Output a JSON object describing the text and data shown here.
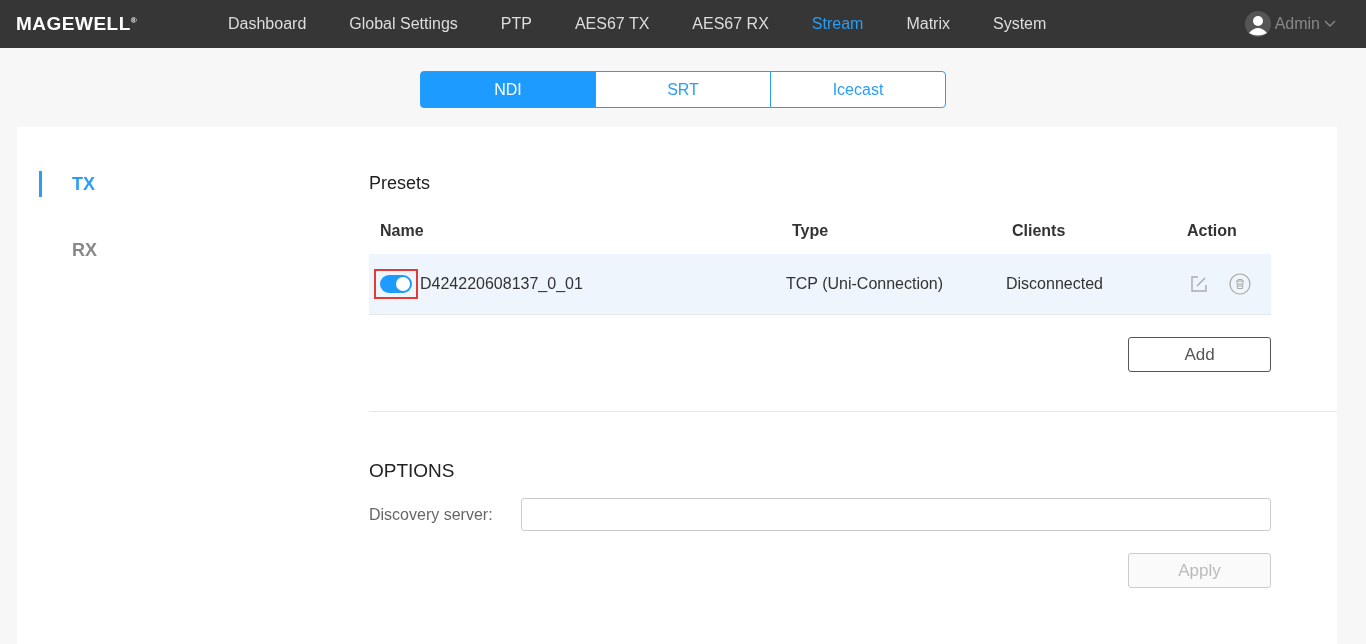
{
  "brand": {
    "logo": "MAGEWELL",
    "mark": "®"
  },
  "nav": [
    {
      "label": "Dashboard",
      "selected": false
    },
    {
      "label": "Global Settings",
      "selected": false
    },
    {
      "label": "PTP",
      "selected": false
    },
    {
      "label": "AES67 TX",
      "selected": false
    },
    {
      "label": "AES67 RX",
      "selected": false
    },
    {
      "label": "Stream",
      "selected": true
    },
    {
      "label": "Matrix",
      "selected": false
    },
    {
      "label": "System",
      "selected": false
    }
  ],
  "user": {
    "name": "Admin"
  },
  "tabs": [
    {
      "label": "NDI",
      "selected": true
    },
    {
      "label": "SRT",
      "selected": false
    },
    {
      "label": "Icecast",
      "selected": false
    }
  ],
  "sidebar": {
    "items": [
      {
        "label": "TX",
        "selected": true
      },
      {
        "label": "RX",
        "selected": false
      }
    ]
  },
  "presets": {
    "title": "Presets",
    "columns": [
      "Name",
      "Type",
      "Clients",
      "Action"
    ],
    "rows": [
      {
        "enabled": true,
        "highlighted": true,
        "name": "D424220608137_0_01",
        "type": "TCP (Uni-Connection)",
        "clients": "Disconnected"
      }
    ],
    "add_button": "Add"
  },
  "options": {
    "title": "OPTIONS",
    "field_label": "Discovery server:",
    "apply_button": {
      "label": "Apply",
      "disabled": true
    }
  }
}
